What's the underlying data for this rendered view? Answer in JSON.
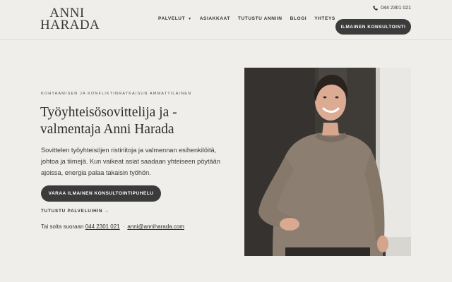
{
  "header": {
    "logo_line1": "ANNI",
    "logo_line2": "HARADA",
    "phone": "044 2301 021",
    "cta": "ILMAINEN KONSULTOINTI",
    "nav": [
      {
        "label": "PALVELUT",
        "has_dropdown": true
      },
      {
        "label": "ASIAKKAAT"
      },
      {
        "label": "TUTUSTU ANNIIN"
      },
      {
        "label": "BLOGI"
      },
      {
        "label": "YHTEYS"
      }
    ]
  },
  "hero": {
    "eyebrow": "KOHTAAMISEN JA KONFLIKTINRATKAISUN AMMATTILAINEN",
    "title": "Työyhteisösovittelija ja -valmentaja Anni Harada",
    "body": "Sovittelen työyhteisöjen ristiriitoja ja valmennan esihenkilöitä, johtoa ja tiimejä. Kun vaikeat asiat saadaan yhteiseen pöytään ajoissa, energia palaa takaisin työhön.",
    "cta": "VARAA ILMAINEN KONSULTOINTIPUHELU",
    "services_link": "TUTUSTU PALVELUIHIN →",
    "contact_prefix": "Tai soita suoraan",
    "contact_phone": "044 2301 021",
    "contact_sep": "·",
    "contact_email": "anni@anniharada.com"
  },
  "colors": {
    "background": "#efeeea",
    "button": "#3b3b3b",
    "text": "#2c2c2c"
  }
}
